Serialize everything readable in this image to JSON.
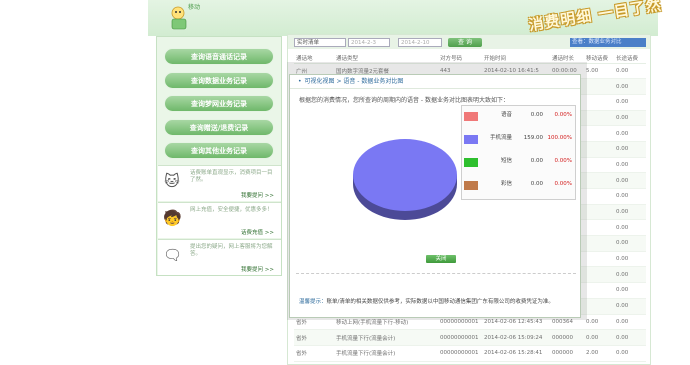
{
  "header": {
    "logo_text": "移动",
    "slogan": "消费明细 一目了然"
  },
  "sidebar": {
    "buttons": [
      "查询语音通话记录",
      "查询数据业务记录",
      "查询梦网业务记录",
      "查询赠送/退费记录",
      "查询其他业务记录"
    ],
    "tips": [
      {
        "text": "话费账单直观显示，消费项目一目了然。",
        "link": "我要提问 >>"
      },
      {
        "text": "网上充值，安全便捷，优惠多多！",
        "link": "话费充值 >>"
      },
      {
        "text": "提出您的疑问，网上客服将为您解答。",
        "link": "我要提问 >>"
      }
    ]
  },
  "filters": {
    "mode": "实时清单",
    "start_date": "2014-2-3",
    "end_date": "2014-2-10",
    "query_button": "查 询",
    "view_select": "查看：数据业务对比"
  },
  "table": {
    "headers": [
      "通话地",
      "通话类型",
      "对方号码",
      "开始时间",
      "通话时长",
      "移动话费",
      "长途话费"
    ],
    "rows": [
      [
        "广州",
        "国内数字流量2元套餐",
        "443",
        "2014-02-10 16:41:5",
        "00:00:00",
        "5.00",
        "0.00"
      ],
      [
        "",
        "",
        "",
        "",
        "",
        "",
        "0.00"
      ],
      [
        "",
        "",
        "",
        "",
        "",
        "",
        "0.00"
      ],
      [
        "",
        "",
        "",
        "",
        "",
        "",
        "0.00"
      ],
      [
        "",
        "",
        "",
        "",
        "",
        "",
        "0.00"
      ],
      [
        "",
        "",
        "",
        "",
        "",
        "",
        "0.00"
      ],
      [
        "",
        "",
        "",
        "",
        "",
        "",
        "0.00"
      ],
      [
        "",
        "",
        "",
        "",
        "",
        "",
        "0.00"
      ],
      [
        "",
        "",
        "",
        "",
        "",
        "",
        "0.00"
      ],
      [
        "",
        "",
        "",
        "",
        "",
        "",
        "0.00"
      ],
      [
        "",
        "",
        "",
        "",
        "",
        "",
        "0.00"
      ],
      [
        "",
        "",
        "",
        "",
        "",
        "",
        "0.00"
      ],
      [
        "",
        "",
        "",
        "",
        "",
        "",
        "0.00"
      ],
      [
        "",
        "",
        "",
        "",
        "",
        "",
        "0.00"
      ],
      [
        "",
        "",
        "",
        "",
        "",
        "",
        "0.00"
      ],
      [
        "",
        "",
        "",
        "",
        "",
        "",
        "0.00"
      ],
      [
        "省外",
        "移动上网(手机流量下行-移动)",
        "00000000001",
        "2014-02-06 12:45:43",
        "000364",
        "0.00",
        "0.00"
      ],
      [
        "省外",
        "手机流量下行(流量会计)",
        "00000000001",
        "2014-02-06 15:09:24",
        "000000",
        "0.00",
        "0.00"
      ],
      [
        "省外",
        "手机流量下行(流量会计)",
        "00000000001",
        "2014-02-06 15:28:41",
        "000000",
        "2.00",
        "0.00"
      ]
    ]
  },
  "modal": {
    "title": "可视化视图 > 语音 - 数据业务对比图",
    "subtitle": "根据您的消费情况，您所查询的周期内的语音 - 数据业务对比图表明大致如下：",
    "close_button": "关闭",
    "note_label": "温馨提示：",
    "note_text": "账单/清单的相关数据仅供参考，实际数据以中国移动通信集团广东有限公司的收费凭证为准。"
  },
  "chart_data": {
    "type": "pie",
    "title": "",
    "series": [
      {
        "name": "语音",
        "value": 0.0,
        "percent": "0.00%",
        "color": "#f07878"
      },
      {
        "name": "手机流量",
        "value": 159.0,
        "percent": "100.00%",
        "color": "#7a78f3"
      },
      {
        "name": "短信",
        "value": 0.0,
        "percent": "0.00%",
        "color": "#2ebf2e"
      },
      {
        "name": "彩信",
        "value": 0.0,
        "percent": "0.00%",
        "color": "#c07a4a"
      }
    ]
  }
}
